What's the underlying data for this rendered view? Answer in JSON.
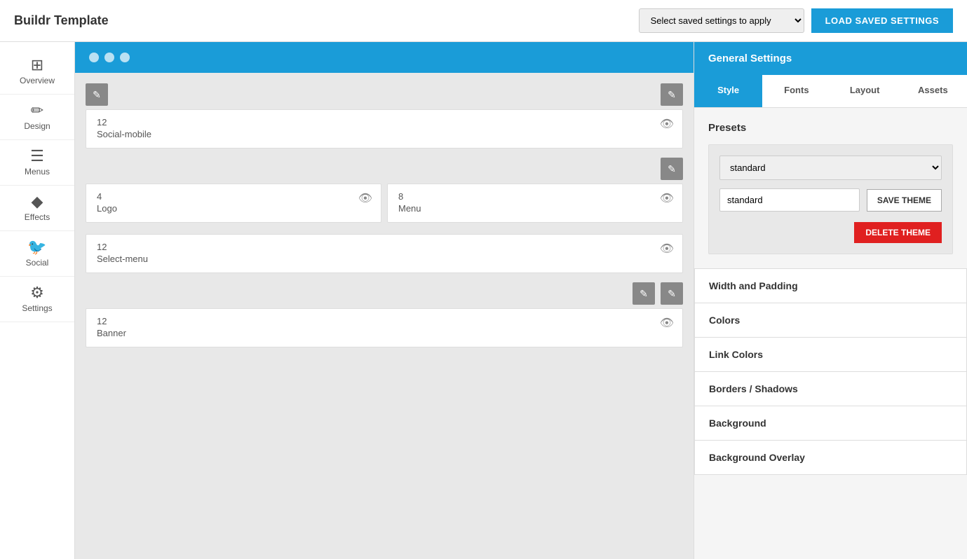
{
  "header": {
    "title": "Buildr Template",
    "select_placeholder": "Select saved settings to apply",
    "load_btn": "LOAD SAVED SETTINGS"
  },
  "sidebar": {
    "items": [
      {
        "id": "overview",
        "label": "Overview",
        "icon": "⊞"
      },
      {
        "id": "design",
        "label": "Design",
        "icon": "✏"
      },
      {
        "id": "menus",
        "label": "Menus",
        "icon": "☰"
      },
      {
        "id": "effects",
        "label": "Effects",
        "icon": "⬡"
      },
      {
        "id": "social",
        "label": "Social",
        "icon": "🐦"
      },
      {
        "id": "settings",
        "label": "Settings",
        "icon": "⚙"
      }
    ]
  },
  "content": {
    "cards": [
      {
        "num": "12",
        "label": "Social-mobile"
      },
      {
        "num": "4",
        "label": "Logo"
      },
      {
        "num": "8",
        "label": "Menu"
      },
      {
        "num": "12",
        "label": "Select-menu"
      },
      {
        "num": "12",
        "label": "Banner"
      }
    ]
  },
  "right_panel": {
    "title": "General Settings",
    "tabs": [
      "Style",
      "Fonts",
      "Layout",
      "Assets"
    ],
    "active_tab": "Style",
    "presets_heading": "Presets",
    "preset_select_value": "standard",
    "preset_input_value": "standard",
    "save_theme_btn": "SAVE THEME",
    "delete_theme_btn": "DELETE THEME",
    "accordion": [
      "Width and Padding",
      "Colors",
      "Link Colors",
      "Borders / Shadows",
      "Background",
      "Background Overlay"
    ]
  }
}
